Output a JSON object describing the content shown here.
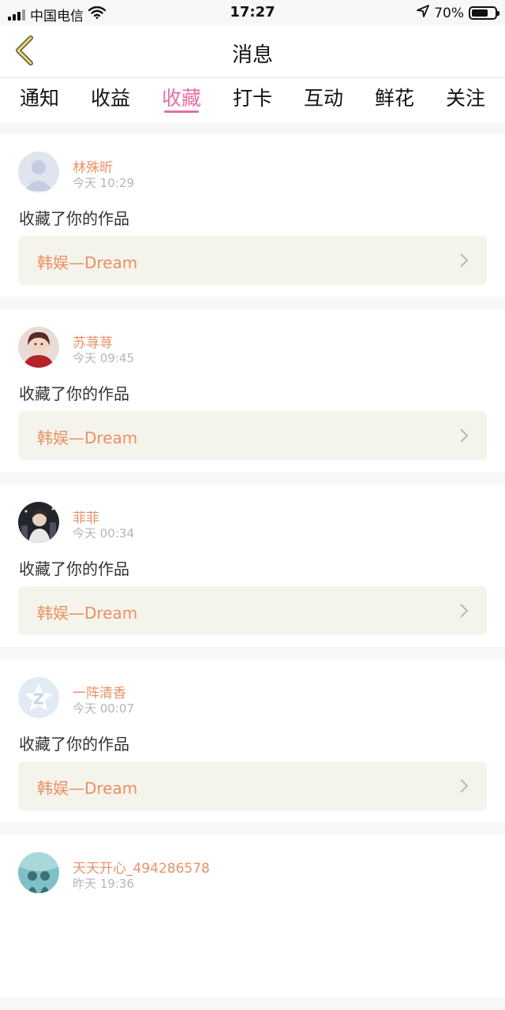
{
  "status_bar": {
    "carrier": "中国电信",
    "time": "17:27",
    "battery_percent": "70%",
    "battery_level": 0.7
  },
  "header": {
    "title": "消息"
  },
  "tabs": [
    {
      "label": "通知"
    },
    {
      "label": "收益"
    },
    {
      "label": "收藏",
      "active": true
    },
    {
      "label": "打卡"
    },
    {
      "label": "互动"
    },
    {
      "label": "鲜花"
    },
    {
      "label": "关注"
    }
  ],
  "feed": [
    {
      "user": "林殊昕",
      "time": "今天 10:29",
      "action": "收藏了你的作品",
      "work": "韩娱—Dream",
      "avatar": "default-person-avatar"
    },
    {
      "user": "苏荨荨",
      "time": "今天 09:45",
      "action": "收藏了你的作品",
      "work": "韩娱—Dream",
      "avatar": "photo-avatar-red"
    },
    {
      "user": "菲菲",
      "time": "今天 00:34",
      "action": "收藏了你的作品",
      "work": "韩娱—Dream",
      "avatar": "photo-avatar-dark"
    },
    {
      "user": "一阵清香",
      "time": "今天 00:07",
      "action": "收藏了你的作品",
      "work": "韩娱—Dream",
      "avatar": "qq-star-avatar"
    },
    {
      "user": "天天开心_494286578",
      "time": "昨天 19:36",
      "action": "",
      "work": "",
      "avatar": "photo-avatar-teal"
    }
  ],
  "colors": {
    "accent": "#e76fa7",
    "name": "#e8926a",
    "work": "#ec8f61"
  }
}
